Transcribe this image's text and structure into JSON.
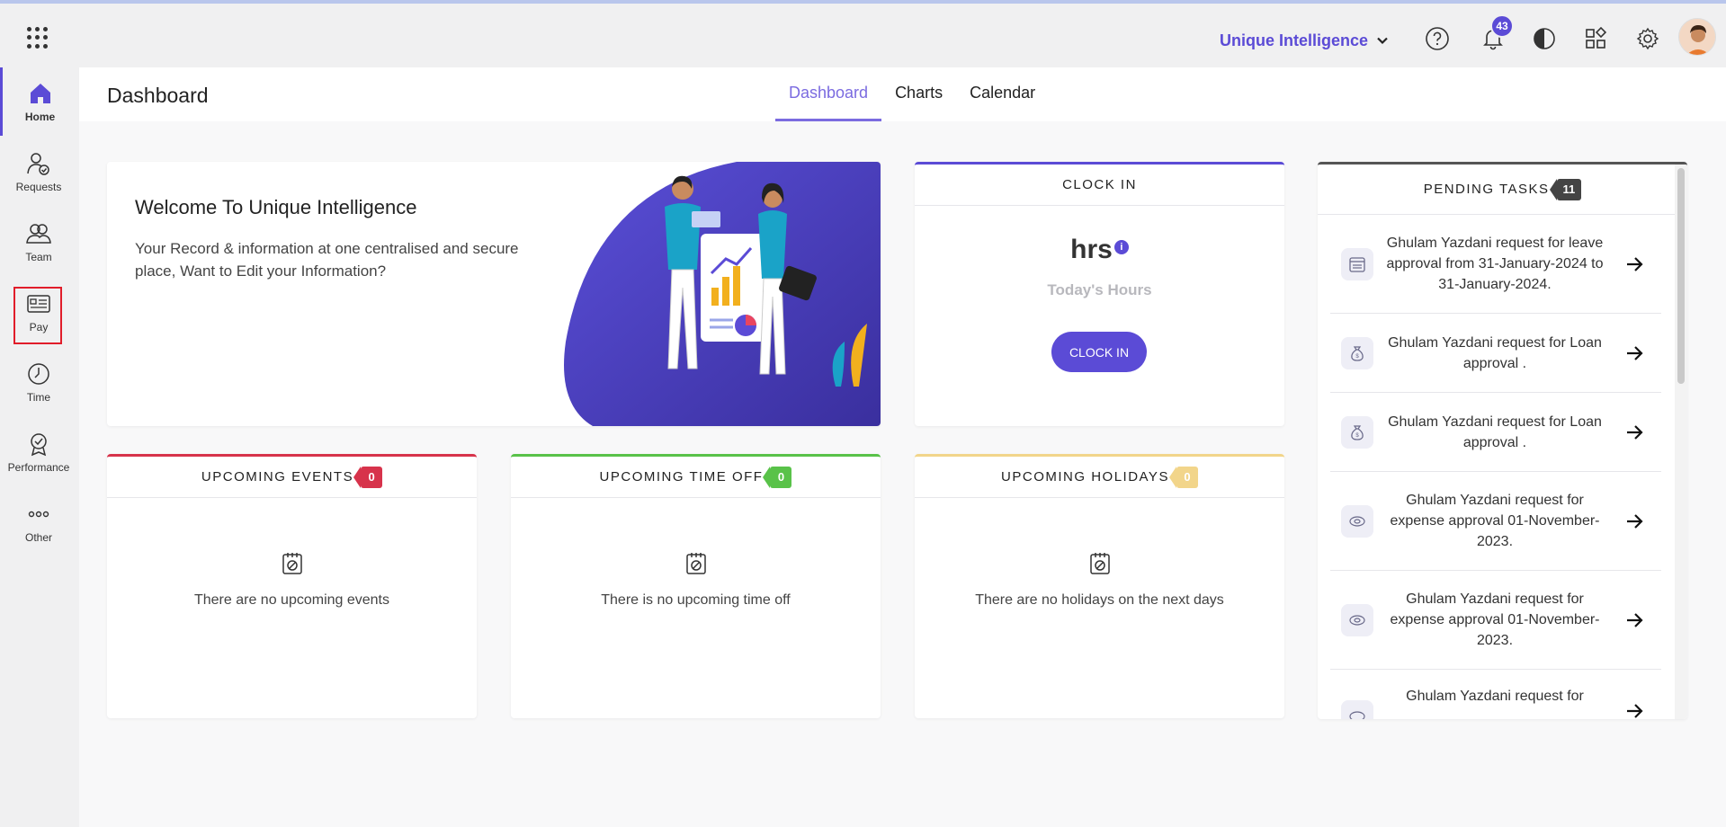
{
  "topbar": {
    "org_name": "Unique Intelligence",
    "notification_count": "43"
  },
  "sidebar": {
    "items": [
      {
        "label": "Home",
        "icon": "home-icon"
      },
      {
        "label": "Requests",
        "icon": "requests-icon"
      },
      {
        "label": "Team",
        "icon": "team-icon"
      },
      {
        "label": "Pay",
        "icon": "pay-icon"
      },
      {
        "label": "Time",
        "icon": "clock-icon"
      },
      {
        "label": "Performance",
        "icon": "award-icon"
      },
      {
        "label": "Other",
        "icon": "more-icon"
      }
    ]
  },
  "header": {
    "title": "Dashboard",
    "tabs": [
      {
        "label": "Dashboard",
        "active": true
      },
      {
        "label": "Charts",
        "active": false
      },
      {
        "label": "Calendar",
        "active": false
      }
    ]
  },
  "welcome": {
    "title": "Welcome To Unique Intelligence",
    "text": "Your Record & information at one centralised and secure place, Want to Edit your Information?"
  },
  "clock": {
    "title": "CLOCK IN",
    "hours": "hrs",
    "info_glyph": "i",
    "today_label": "Today's Hours",
    "button": "CLOCK IN"
  },
  "events": {
    "title": "UPCOMING EVENTS",
    "count": "0",
    "empty": "There are no upcoming events"
  },
  "timeoff": {
    "title": "UPCOMING TIME OFF",
    "count": "0",
    "empty": "There is no upcoming time off"
  },
  "holidays": {
    "title": "UPCOMING HOLIDAYS",
    "count": "0",
    "empty": "There are no holidays on the next days"
  },
  "pending": {
    "title": "PENDING TASKS",
    "count": "11",
    "tasks": [
      {
        "icon": "calendar-icon",
        "text": "Ghulam Yazdani request for leave approval from 31-January-2024 to 31-January-2024."
      },
      {
        "icon": "money-bag-icon",
        "text": "Ghulam Yazdani request for Loan approval ."
      },
      {
        "icon": "money-bag-icon",
        "text": "Ghulam Yazdani request for Loan approval ."
      },
      {
        "icon": "expense-icon",
        "text": "Ghulam Yazdani request for expense approval 01-November-2023."
      },
      {
        "icon": "expense-icon",
        "text": "Ghulam Yazdani request for expense approval 01-November-2023."
      },
      {
        "icon": "expense-icon",
        "text": "Ghulam Yazdani request for"
      }
    ]
  },
  "colors": {
    "accent": "#5b4bd6",
    "events": "#d7334b",
    "timeoff": "#59c249",
    "holidays": "#f2d58a",
    "highlight": "#e11d2a"
  }
}
